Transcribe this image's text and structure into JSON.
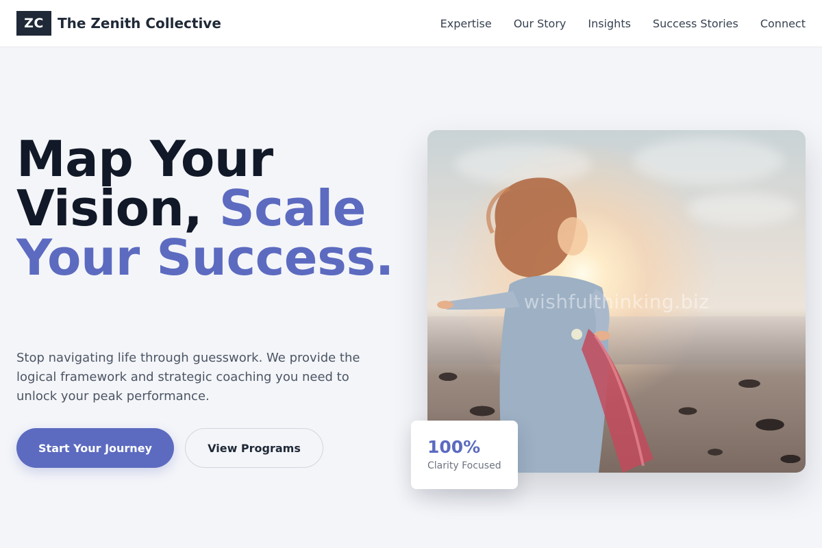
{
  "header": {
    "logo_mark": "ZC",
    "brand_name": "The Zenith Collective",
    "nav": [
      "Expertise",
      "Our Story",
      "Insights",
      "Success Stories",
      "Connect"
    ]
  },
  "hero": {
    "title_dark": "Map Your Vision,",
    "title_accent": "Scale Your Success.",
    "description": "Stop navigating life through guesswork. We provide the logical framework and strategic coaching you need to unlock your peak performance.",
    "primary_button": "Start Your Journey",
    "secondary_button": "View Programs",
    "image_watermark": "wishfulthinking.biz"
  },
  "stat": {
    "value": "100%",
    "label": "Clarity Focused"
  },
  "colors": {
    "accent": "#5c6bc0",
    "dark": "#111827",
    "background": "#f4f5f9"
  }
}
